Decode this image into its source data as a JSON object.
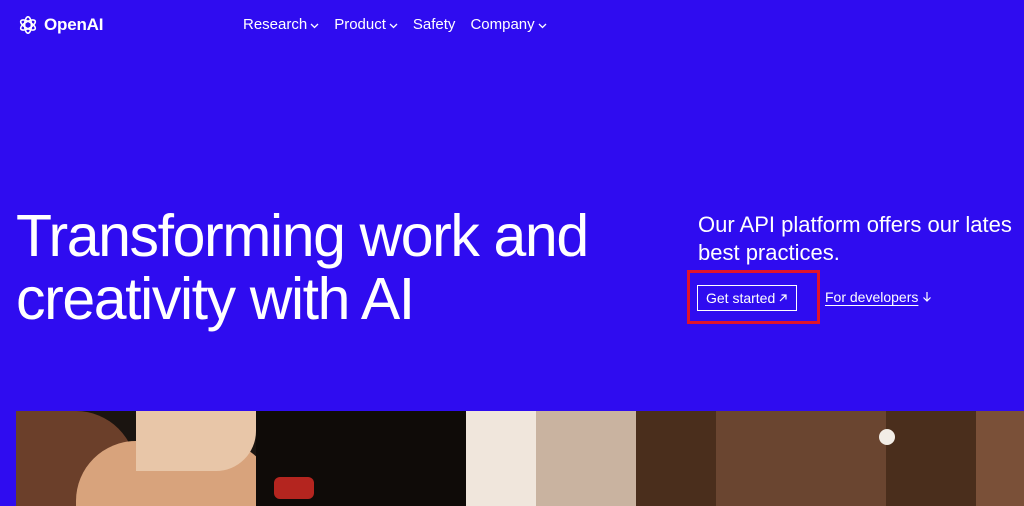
{
  "brand": {
    "name": "OpenAI",
    "icon": "openai-logo-icon"
  },
  "nav": {
    "items": [
      {
        "label": "Research",
        "has_dropdown": true
      },
      {
        "label": "Product",
        "has_dropdown": true
      },
      {
        "label": "Safety",
        "has_dropdown": false
      },
      {
        "label": "Company",
        "has_dropdown": true
      }
    ]
  },
  "hero": {
    "title_lines": [
      "Transforming work and",
      "creativity with AI"
    ],
    "lead_lines": [
      "Our API platform offers our lates",
      "best practices."
    ],
    "cta_primary": "Get started",
    "cta_secondary": "For developers"
  },
  "colors": {
    "background": "#2f0cf0",
    "text": "#ffffff",
    "highlight": "#e0142a"
  }
}
